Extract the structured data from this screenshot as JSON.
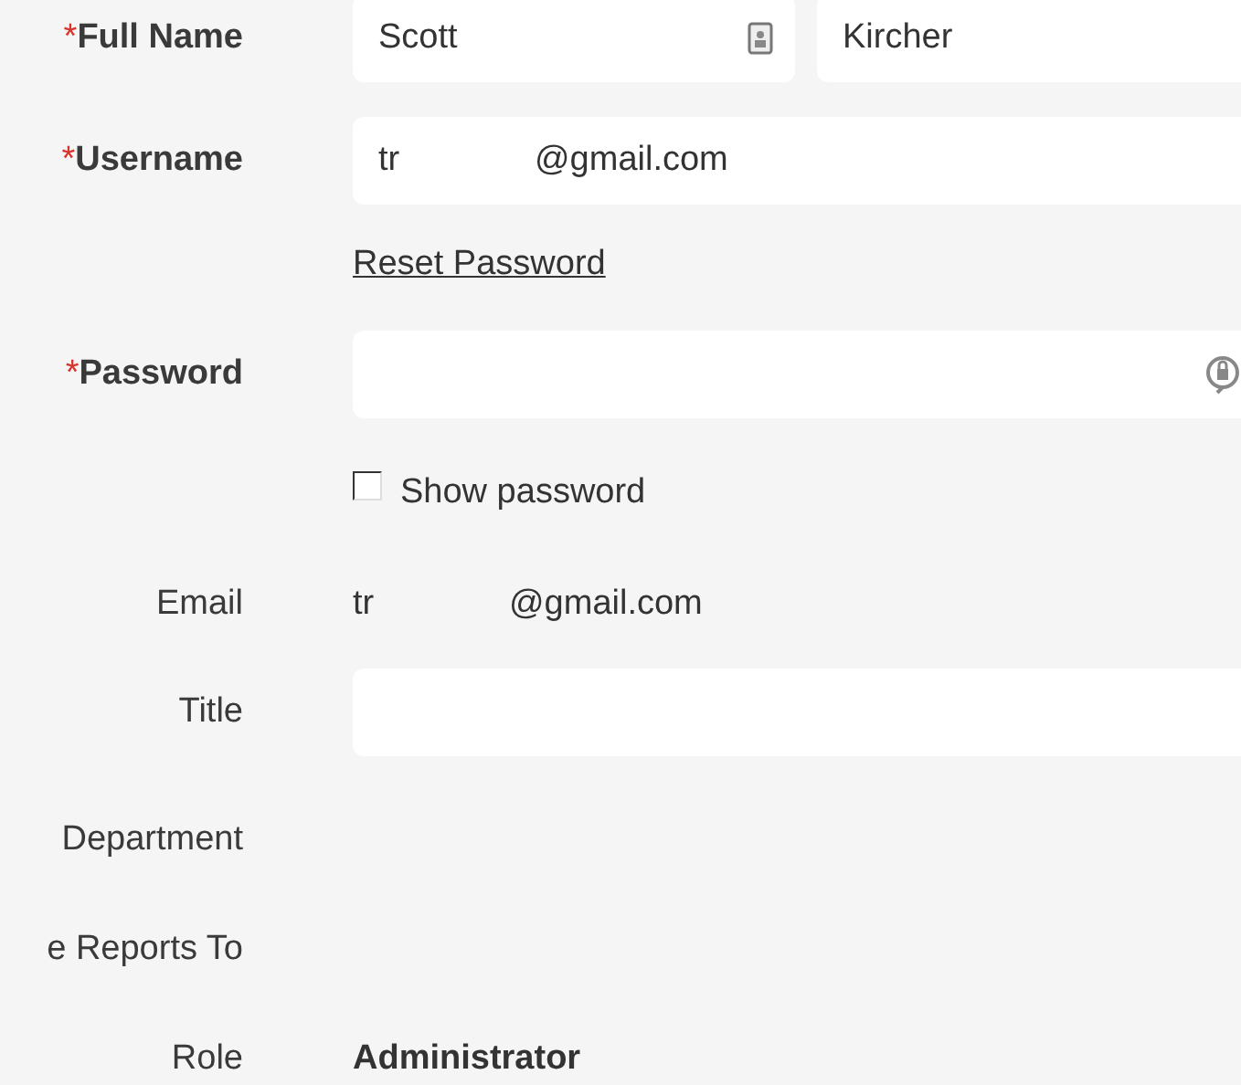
{
  "form": {
    "rows": [
      {
        "kind": "name_pair",
        "label": "Full Name",
        "required": true,
        "mark": "*",
        "values": [
          "Scott",
          "Kircher"
        ]
      },
      {
        "kind": "field",
        "label": "Username",
        "required": true,
        "mark": "*",
        "value": "tr              @gmail.com"
      },
      {
        "kind": "link",
        "text": "Reset Password"
      },
      {
        "kind": "password",
        "label": "Password",
        "required": true,
        "mark": "*",
        "value": ""
      },
      {
        "kind": "checkbox",
        "text": "Show password",
        "checked": false
      },
      {
        "kind": "text",
        "label": "Email",
        "required": false,
        "value": "tr              @gmail.com"
      },
      {
        "kind": "field",
        "label": "Title",
        "required": false,
        "value": ""
      },
      {
        "kind": "text",
        "label": "Department",
        "required": false,
        "value": ""
      },
      {
        "kind": "text",
        "label": "e Reports To",
        "required": false,
        "value": ""
      },
      {
        "kind": "bold_text",
        "label": "Role",
        "required": false,
        "value": "Administrator"
      }
    ]
  }
}
